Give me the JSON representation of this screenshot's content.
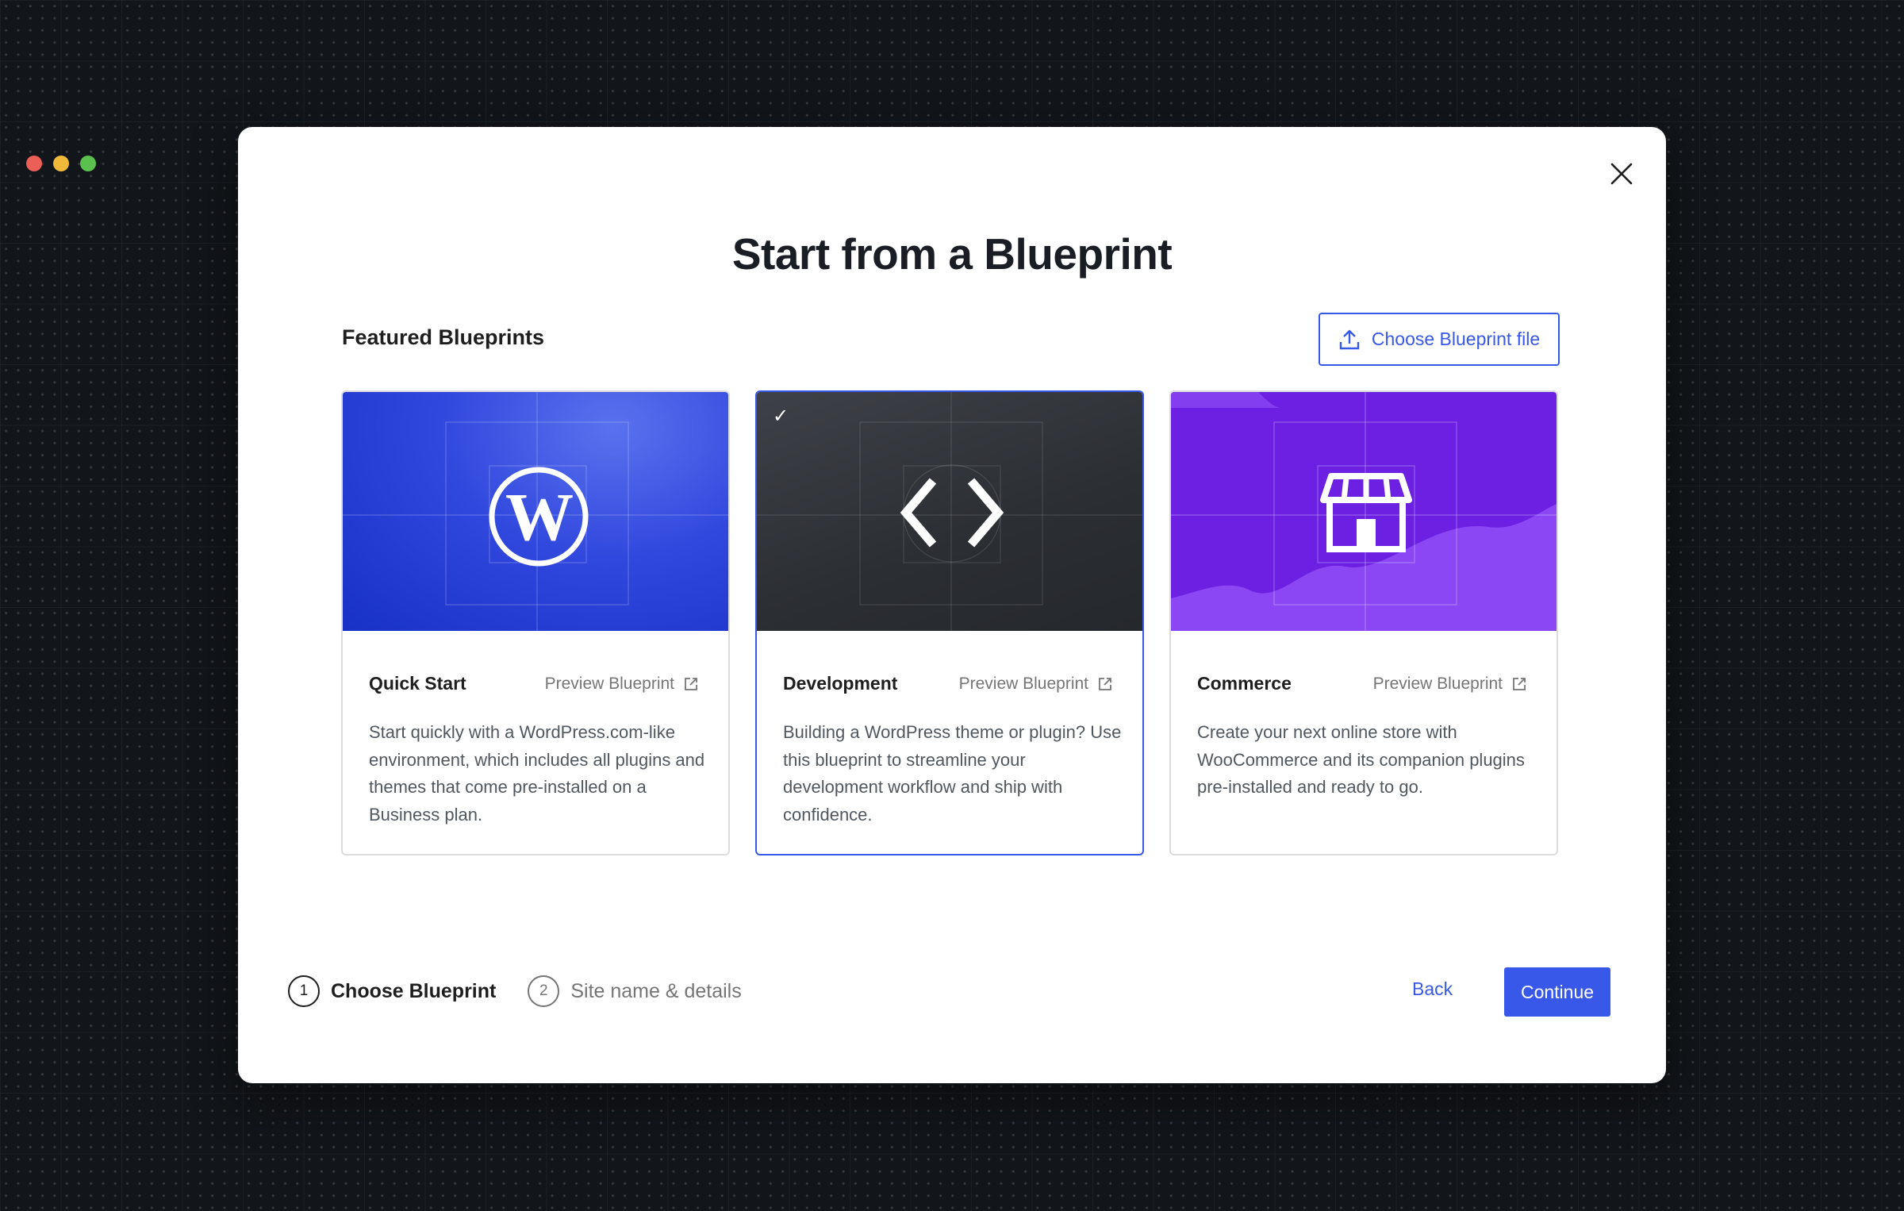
{
  "window": {
    "traffic_lights": [
      {
        "name": "close",
        "color": "#ec5f57"
      },
      {
        "name": "minimize",
        "color": "#f0b93a"
      },
      {
        "name": "zoom",
        "color": "#5ac04e"
      }
    ],
    "close_icon": "close-icon"
  },
  "title": "Start from a Blueprint",
  "section_label": "Featured Blueprints",
  "choose_file": {
    "label": "Choose Blueprint file",
    "icon": "upload-icon"
  },
  "cards": [
    {
      "name": "Quick Start",
      "preview": "Preview Blueprint",
      "description": "Start quickly with a WordPress.com-like environment, which includes all plugins and themes that come pre-installed on a Business plan.",
      "icon": "wordpress-logo-icon",
      "selected": false,
      "colors": {
        "from": "#4a62e6",
        "to": "#1530c4"
      }
    },
    {
      "name": "Development",
      "preview": "Preview Blueprint",
      "description": "Building a WordPress theme or plugin? Use this blueprint to streamline your development workflow and ship with confidence.",
      "icon": "code-brackets-icon",
      "selected": true,
      "check": "✓",
      "colors": {
        "from": "#3b3e44",
        "to": "#25282d"
      }
    },
    {
      "name": "Commerce",
      "preview": "Preview Blueprint",
      "description": "Create your next online store with WooCommerce and its companion plugins pre-installed and ready to go.",
      "icon": "storefront-icon",
      "selected": false,
      "colors": {
        "from": "#6d22e6",
        "to": "#8845f2"
      }
    }
  ],
  "steps": [
    {
      "num": "1",
      "label": "Choose Blueprint",
      "active": true
    },
    {
      "num": "2",
      "label": "Site name & details",
      "active": false
    }
  ],
  "footer": {
    "back": "Back",
    "continue": "Continue"
  },
  "colors": {
    "accent": "#3858e9",
    "text": "#1e1e1e",
    "muted": "#757575"
  }
}
